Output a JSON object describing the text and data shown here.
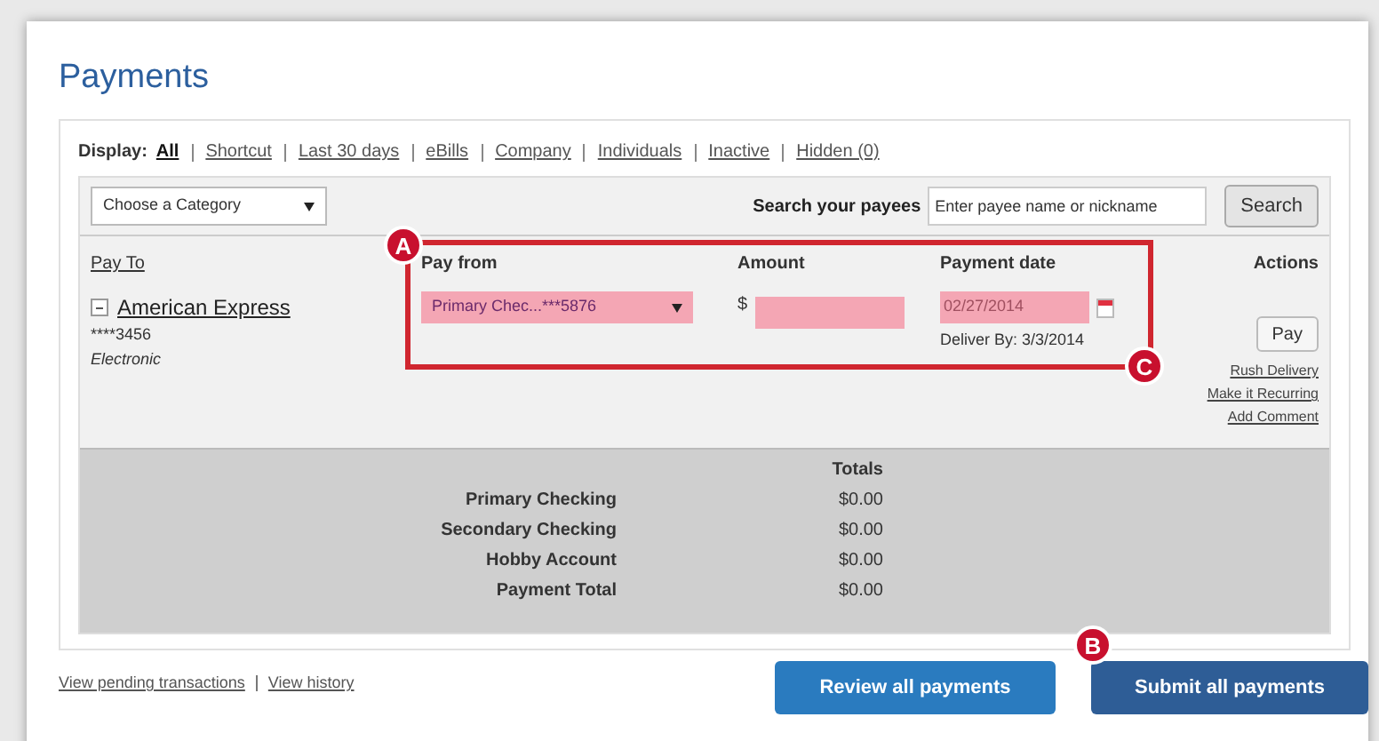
{
  "page": {
    "title": "Payments"
  },
  "display": {
    "label": "Display:",
    "filters": [
      {
        "label": "All",
        "selected": true
      },
      {
        "label": "Shortcut",
        "selected": false
      },
      {
        "label": "Last 30 days",
        "selected": false
      },
      {
        "label": "eBills",
        "selected": false
      },
      {
        "label": "Company",
        "selected": false
      },
      {
        "label": "Individuals",
        "selected": false
      },
      {
        "label": "Inactive",
        "selected": false
      },
      {
        "label": "Hidden (0)",
        "selected": false
      }
    ]
  },
  "toolbar": {
    "category": "Choose a Category",
    "search_label": "Search your payees",
    "search": {
      "placeholder": "Enter payee name or nickname"
    },
    "search_button": "Search"
  },
  "table": {
    "columns": [
      "Pay To",
      "Pay from",
      "Amount",
      "Payment date",
      "Actions"
    ],
    "rows": [
      {
        "expanded": true,
        "payee": "American Express",
        "account": "****3456",
        "method": "Electronic",
        "pay_from": "Primary Chec...***5876",
        "currency": "$",
        "payment_date": "02/27/2014",
        "deliver_by": "Deliver By: 3/3/2014",
        "pay_button": "Pay",
        "links": [
          "Rush Delivery",
          "Make it Recurring",
          "Add Comment"
        ]
      }
    ]
  },
  "totals": {
    "heading": "Totals",
    "rows": [
      {
        "label": "Primary Checking",
        "value": "$0.00"
      },
      {
        "label": "Secondary Checking",
        "value": "$0.00"
      },
      {
        "label": "Hobby Account",
        "value": "$0.00"
      },
      {
        "label": "Payment Total",
        "value": "$0.00"
      }
    ]
  },
  "footer": {
    "links": [
      "View pending transactions",
      "View history"
    ],
    "buttons": [
      "Review all payments",
      "Submit all payments"
    ]
  },
  "callouts": [
    "A",
    "B",
    "C"
  ]
}
